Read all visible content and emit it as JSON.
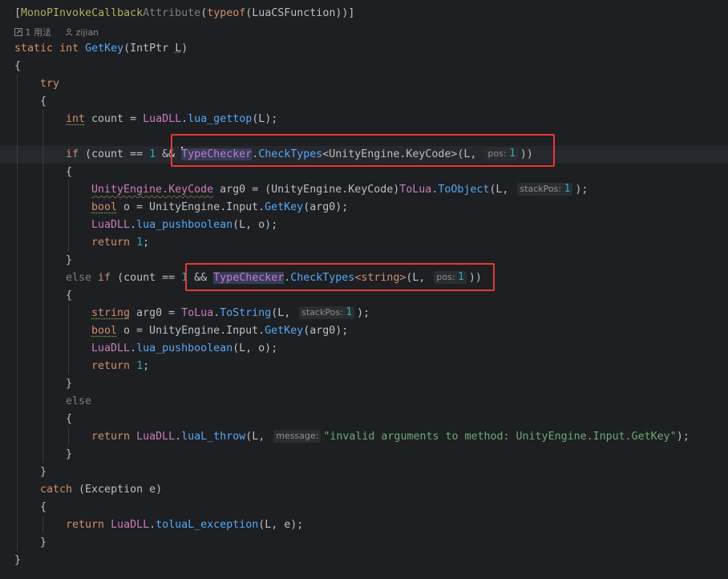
{
  "editor": {
    "attribute_line": {
      "open": "[",
      "attr_name": "MonoPInvokeCallback",
      "attr_suffix": "Attribute",
      "paren": "(",
      "typeof_kw": "typeof",
      "arg": "(LuaCSFunction))]"
    },
    "usage_hint": {
      "usages_icon": "external-link-icon",
      "usages_text": "1 用法",
      "author_icon": "person-icon",
      "author_text": "zijian"
    },
    "signature": {
      "static_kw": "static",
      "int_kw": "int",
      "method": "GetKey",
      "params": "(IntPtr ",
      "param_name": "L",
      "close": ")"
    },
    "braces": {
      "open": "{",
      "close": "}"
    },
    "try_kw": "try",
    "catch_kw": "catch",
    "catch_rest": " (Exception e)",
    "if_kw": "if",
    "else_kw": "else",
    "return_kw": "return",
    "count_line": {
      "type": "int",
      "rest1": " count = ",
      "cls": "LuaDLL",
      "dot": ".",
      "fn": "lua_gettop",
      "rest2": "(L);"
    },
    "if1": {
      "pre": " (count == ",
      "one": "1",
      "and": " && ",
      "cls": "TypeChecker",
      "dot": ".",
      "fn": "CheckTypes",
      "generic": "<UnityEngine.KeyCode>",
      "args": "(L, ",
      "inlay_name": "pos:",
      "inlay_val": "1",
      "close": "))"
    },
    "body1": {
      "l1_type": "UnityEngine.KeyCode",
      "l1_rest": " arg0 = (UnityEngine.KeyCode)",
      "l1_cls": "ToLua",
      "l1_fn": "ToObject",
      "l1_args": "(L, ",
      "l1_inlay_name": "stackPos:",
      "l1_inlay_val": "1",
      "l1_close": ");",
      "l2_type": "bool",
      "l2_rest": " o = UnityEngine.Input.",
      "l2_fn": "GetKey",
      "l2_args": "(arg0);",
      "l3_cls": "LuaDLL",
      "l3_fn": "lua_pushboolean",
      "l3_args": "(L, o);",
      "l4_val": "1",
      "l4_end": ";"
    },
    "elseif": {
      "pre": " (count == ",
      "one": "1",
      "and": " && ",
      "cls": "TypeChecker",
      "fn": "CheckTypes",
      "generic": "<string>",
      "args": "(L, ",
      "inlay_name": "pos:",
      "inlay_val": "1",
      "close": "))"
    },
    "body2": {
      "l1_type": "string",
      "l1_rest": " arg0 = ",
      "l1_cls": "ToLua",
      "l1_fn": "ToString",
      "l1_args": "(L, ",
      "l1_inlay_name": "stackPos:",
      "l1_inlay_val": "1",
      "l1_close": ");",
      "l2_type": "bool",
      "l2_rest": " o = UnityEngine.Input.",
      "l2_fn": "GetKey",
      "l2_args": "(arg0);",
      "l3_cls": "LuaDLL",
      "l3_fn": "lua_pushboolean",
      "l3_args": "(L, o);",
      "l4_val": "1",
      "l4_end": ";"
    },
    "else_body": {
      "cls": "LuaDLL",
      "fn": "luaL_throw",
      "args": "(L, ",
      "inlay_name": "message:",
      "str": "\"invalid arguments to method: UnityEngine.Input.GetKey\"",
      "close": ");"
    },
    "catch_body": {
      "cls": "LuaDLL",
      "fn": "toluaL_exception",
      "args": "(L, e);"
    },
    "colors": {
      "background": "#1e1f22",
      "keyword": "#cf8e6d",
      "method": "#56a8f5",
      "number": "#2aacb8",
      "string": "#6aab73",
      "annotation_box": "#e53935"
    }
  }
}
